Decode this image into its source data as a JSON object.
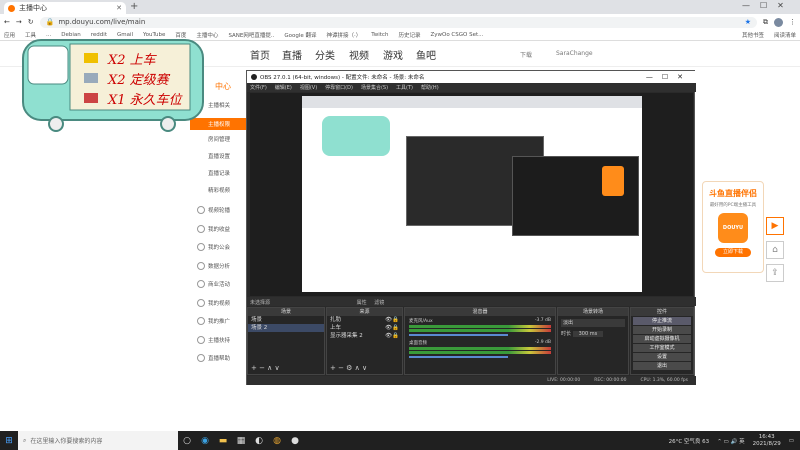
{
  "browser": {
    "tab_title": "主播中心",
    "new_tab": "+",
    "url": "mp.douyu.com/live/main",
    "bookmarks": [
      "应用",
      "工具",
      "...",
      "Debian",
      "reddit",
      "Gmail",
      "YouTube",
      "百度",
      "主播中心",
      "SANE网吧直播提..",
      "Google 翻译",
      "神谭拼接（·）",
      "Twitch",
      "历史记录",
      "ZywOo CSGO Set...",
      "其他书签",
      "阅读清单"
    ]
  },
  "site": {
    "nav": [
      "首页",
      "直播",
      "分类",
      "视频",
      "游戏",
      "鱼吧"
    ],
    "download": "下载",
    "user": "SaraChange",
    "center": "中心",
    "menu": [
      "主播相关",
      "主播权限",
      "房间管理",
      "直播设置",
      "直播记录",
      "精彩视频",
      "视频轮播",
      "我的收益",
      "我的公会",
      "数据分析",
      "商业活动",
      "我的视频",
      "我的推广",
      "主播扶持",
      "直播帮助"
    ]
  },
  "banner": {
    "line1": "X2 上车",
    "line2": "X2 定级赛",
    "line3": "X1 永久车位"
  },
  "obs": {
    "title": "OBS 27.0.1 (64-bit, windows) - 配置文件: 未命名 - 场景: 未命名",
    "menu": [
      "文件(F)",
      "编辑(E)",
      "视图(V)",
      "停靠窗口(D)",
      "场景集合(S)",
      "工具(T)",
      "帮助(H)"
    ],
    "unselected": "未选择源",
    "properties": "属性",
    "filters": "滤镜",
    "headers": {
      "scenes": "场景",
      "sources": "来源",
      "mixer": "混音器",
      "transitions": "场景转场",
      "controls": "控件"
    },
    "scenes": [
      "场景",
      "场景 2"
    ],
    "sources": [
      "扎肋",
      "上车",
      "显示器采集 2"
    ],
    "mixer": [
      {
        "name": "麦克风/Aux",
        "db": "-3.7 dB"
      },
      {
        "name": "桌面音频",
        "db": "-2.9 dB"
      }
    ],
    "transition": {
      "type": "淡出",
      "duration_label": "时长",
      "duration": "300 ms"
    },
    "controls": [
      "停止推流",
      "开始录制",
      "启动虚拟摄像机",
      "工作室模式",
      "设置",
      "退出"
    ],
    "status": {
      "live": "LIVE: 00:00:00",
      "rec": "REC: 00:00:00",
      "cpu": "CPU: 1.3%, 60.00 fps"
    }
  },
  "ad": {
    "title": "斗鱼直播伴侣",
    "subtitle": "最好用的PC端主播工具",
    "button": "立即下载",
    "logo": "DOUYU"
  },
  "taskbar": {
    "search": "在这里输入你要搜索的内容",
    "weather": "26°C 空气良 63",
    "time": "16:43",
    "date": "2021/8/29"
  },
  "colors": {
    "accent": "#ff7300",
    "obs_bg": "#2a2a2a",
    "taskbar": "#202020"
  }
}
